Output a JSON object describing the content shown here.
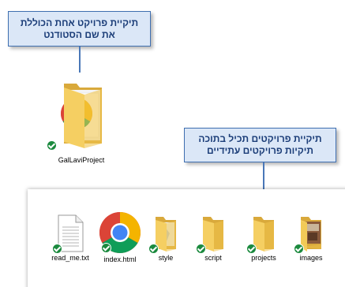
{
  "callouts": {
    "top": {
      "line1": "תיקיית פרויקט אחת הכוללת",
      "line2": "את שם הסטודנט"
    },
    "bottom": {
      "line1": "תיקיית פרויקטים תכיל בתוכה",
      "line2": "תיקיות פרויקטים עתידיים"
    }
  },
  "main_folder": {
    "name": "GalLaviProject",
    "icon": "folder-with-chrome-icon"
  },
  "explorer_items": [
    {
      "name": "read_me.txt",
      "icon": "text-file-icon"
    },
    {
      "name": "index.html",
      "icon": "chrome-icon"
    },
    {
      "name": "style",
      "icon": "folder-icon"
    },
    {
      "name": "script",
      "icon": "folder-icon"
    },
    {
      "name": "projects",
      "icon": "folder-icon"
    },
    {
      "name": "images",
      "icon": "image-folder-icon"
    }
  ],
  "colors": {
    "callout_fill": "#dbe7f7",
    "callout_border": "#3f6fb0",
    "callout_text": "#1b3d78",
    "folder_yellow": "#f5cf62",
    "sync_check": "#1b8a3e"
  }
}
